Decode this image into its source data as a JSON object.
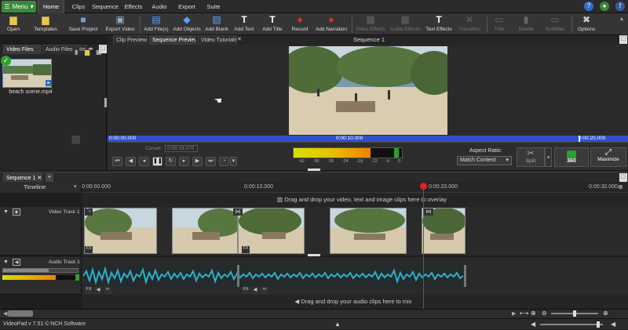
{
  "menu": {
    "menu_label": "Menu"
  },
  "menu_tabs": [
    "Home",
    "Clips",
    "Sequence",
    "Effects",
    "Audio",
    "Export",
    "Suite"
  ],
  "toolbar": {
    "open": "Open",
    "templates": "Templates",
    "save_project": "Save Project",
    "export_video": "Export Video",
    "add_files": "Add File(s)",
    "add_objects": "Add Objects",
    "add_blank": "Add Blank",
    "add_text": "Add Text",
    "add_title": "Add Title",
    "record": "Record",
    "add_narration": "Add Narration",
    "video_effects": "Video Effects",
    "audio_effects": "Audio Effects",
    "text_effects": "Text Effects",
    "transition": "Transition",
    "trim": "Trim",
    "delete": "Delete",
    "subtitles": "Subtitles",
    "options": "Options"
  },
  "bin": {
    "tabs": [
      "Video Files",
      "Audio Files",
      "Im"
    ],
    "file_name": "beach scene.mp4"
  },
  "preview": {
    "tabs": [
      "Clip Preview",
      "Sequence Preview",
      "Video Tutorials"
    ],
    "title": "Sequence 1",
    "time_start": "0:00:00.000",
    "time_mid": "0:00:10.000",
    "time_end": "0:00:20.000",
    "cursor_label": "Cursor:",
    "cursor_value": "0:00:19.070",
    "meter_ticks": [
      "-42",
      "-36",
      "-30",
      "-24",
      "-18",
      "-12",
      "-6",
      "0"
    ],
    "aspect_label": "Aspect Ratio:",
    "aspect_value": "Match Content",
    "split": "Split",
    "three60": "360",
    "maximize": "Maximize"
  },
  "timeline": {
    "seq_tab": "Sequence 1",
    "label": "Timeline",
    "ticks": [
      "0:00:00.000",
      "0:00:10.000",
      "0:00:20.000",
      "0:00:30.000"
    ],
    "video_track": "Video Track 1",
    "audio_track": "Audio Track 1",
    "video_drop": "Drag and drop your video, text and image clips here to overlay",
    "audio_drop": "Drag and drop your audio clips here to mix"
  },
  "status": {
    "text": "VideoPad v 7.51 © NCH Software"
  },
  "colors": {
    "accent_green": "#3a8a3a",
    "scrub_blue": "#3150c8",
    "playhead": "#e02020",
    "waveform": "#2ab0c8"
  }
}
